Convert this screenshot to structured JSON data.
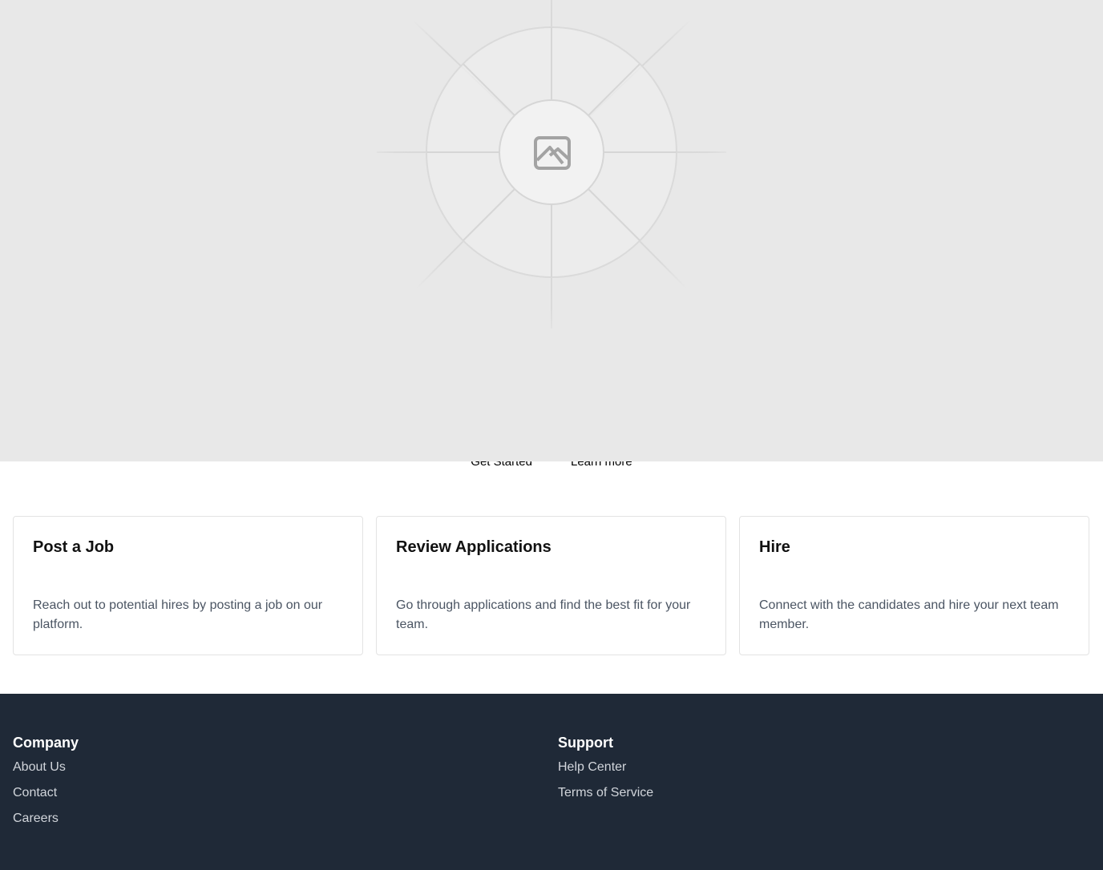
{
  "hero": {
    "image_icon": "image-placeholder-icon",
    "buttons": {
      "primary_label": "Get Started",
      "secondary_label": "Learn more"
    }
  },
  "features": [
    {
      "title": "Post a Job",
      "description": "Reach out to potential hires by posting a job on our platform."
    },
    {
      "title": "Review Applications",
      "description": "Go through applications and find the best fit for your team."
    },
    {
      "title": "Hire",
      "description": "Connect with the candidates and hire your next team member."
    }
  ],
  "footer": {
    "columns": [
      {
        "heading": "Company",
        "links": [
          "About Us",
          "Contact",
          "Careers"
        ]
      },
      {
        "heading": "Support",
        "links": [
          "Help Center",
          "Terms of Service"
        ]
      }
    ]
  },
  "colors": {
    "hero_placeholder_bg": "#e8e8e8",
    "footer_bg": "#1f2937",
    "footer_link": "#d1d5db",
    "card_text": "#4b5563"
  }
}
